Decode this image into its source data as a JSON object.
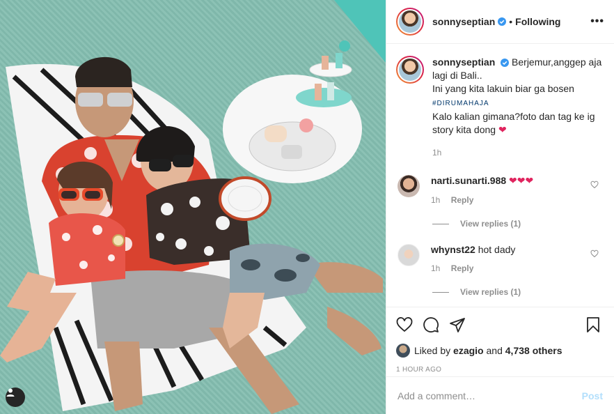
{
  "post": {
    "username": "sonnyseptian",
    "follow_status": "Following",
    "separator": "•",
    "more_label": "•••"
  },
  "caption": {
    "username": "sonnyseptian",
    "line1": "Berjemur,anggep aja lagi di Bali..",
    "line2": "Ini yang kita lakuin biar ga bosen",
    "hashtag": "#DIRUMAHAJA",
    "line3": "Kalo kalian gimana?foto dan tag ke ig story kita dong",
    "emoji": "❤",
    "time": "1h"
  },
  "comments": [
    {
      "username": "narti.sunarti.988",
      "text": "❤❤❤",
      "time": "1h",
      "reply_label": "Reply",
      "view_replies": "View replies (1)"
    },
    {
      "username": "whynst22",
      "text": "hot dady",
      "time": "1h",
      "reply_label": "Reply",
      "view_replies": "View replies (1)"
    }
  ],
  "likes": {
    "prefix": "Liked by",
    "user": "ezagio",
    "conjunction": "and",
    "others": "4,738 others"
  },
  "posted_ago": "1 HOUR AGO",
  "comment_box": {
    "placeholder": "Add a comment…",
    "post_label": "Post"
  },
  "icons": {
    "like": "heart-icon",
    "comment": "comment-icon",
    "share": "share-icon",
    "save": "bookmark-icon",
    "user_tag": "user-icon"
  },
  "colors": {
    "verified": "#3897f0",
    "link": "#00376b",
    "post_disabled": "#b2dffc",
    "heart": "#e0245e"
  }
}
